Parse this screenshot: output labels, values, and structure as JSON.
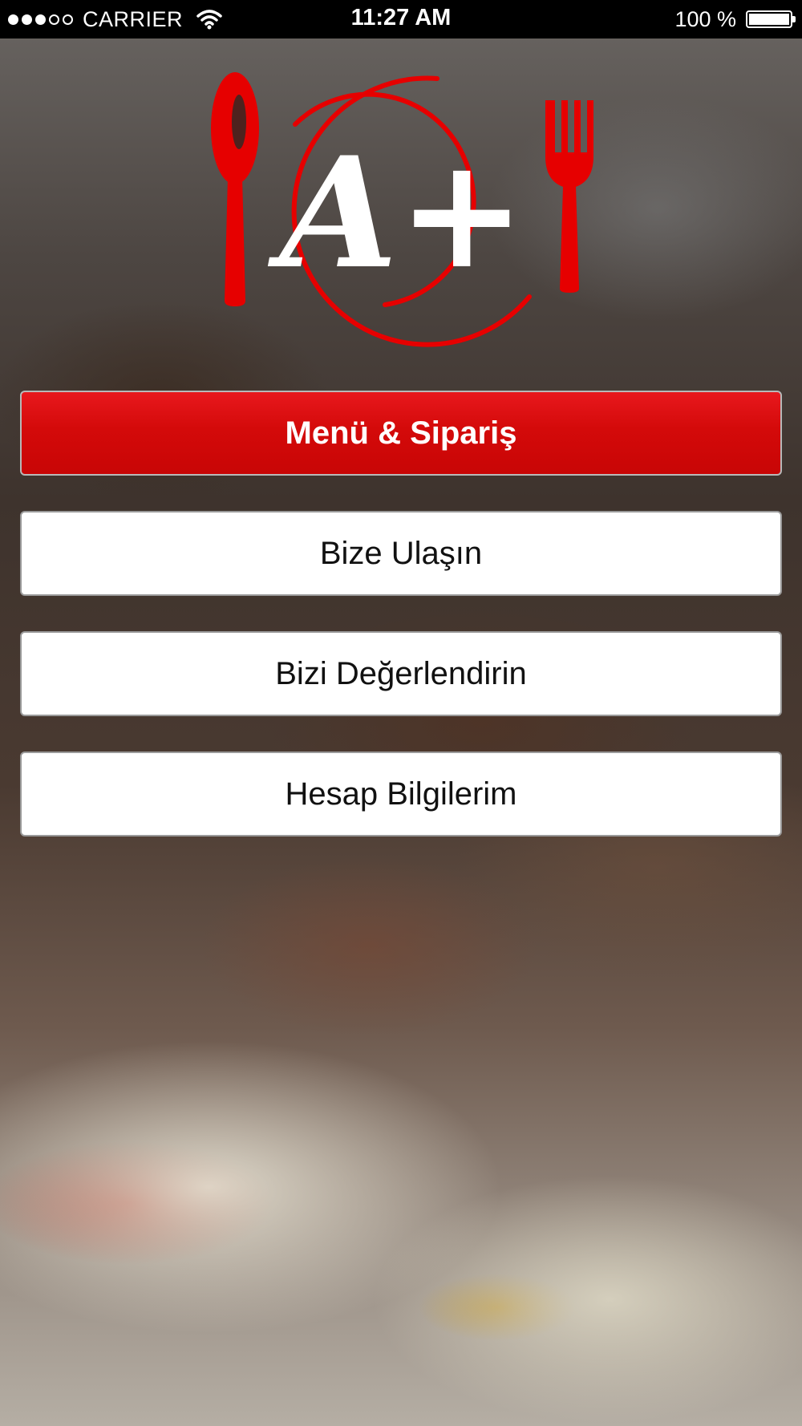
{
  "status_bar": {
    "signal_dots_filled": 3,
    "signal_dots_total": 5,
    "carrier": "CARRIER",
    "time": "11:27 AM",
    "battery_text": "100 %",
    "battery_level": 1.0
  },
  "logo": {
    "text": "A+",
    "accent_color": "#e60000",
    "icons": [
      "spoon-icon",
      "fork-icon"
    ]
  },
  "menu": {
    "items": [
      {
        "label": "Menü & Sipariş",
        "style": "primary",
        "color": "#d40a0a"
      },
      {
        "label": "Bize Ulaşın",
        "style": "default"
      },
      {
        "label": "Bizi Değerlendirin",
        "style": "default"
      },
      {
        "label": "Hesap Bilgilerim",
        "style": "default"
      }
    ]
  }
}
